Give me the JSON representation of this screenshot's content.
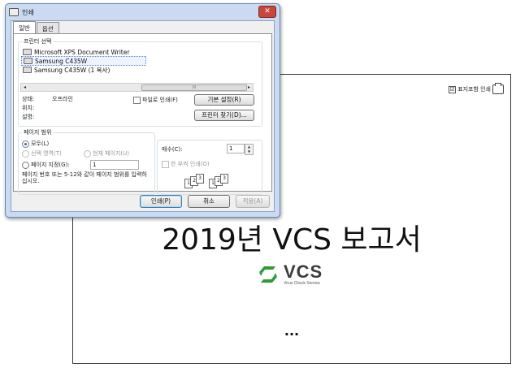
{
  "report": {
    "cover_option": "표지포함 인쇄",
    "cover_checked": "☑",
    "title": "2019년 VCS 보고서",
    "logo_text": "VCS",
    "logo_sub": "Virus Check Service",
    "ellipsis": "...",
    "colors": {
      "logo_green": "#2e9a3a"
    }
  },
  "dialog": {
    "title": "인쇄",
    "close": "✕",
    "tabs": [
      {
        "label": "일반"
      },
      {
        "label": "옵션"
      }
    ],
    "printer_section": {
      "legend": "프린터 선택",
      "printers": [
        {
          "label": "Microsoft XPS Document Writer"
        },
        {
          "label": "Samsung C435W"
        },
        {
          "label": "Samsung C435W (1 복사)"
        }
      ],
      "scroll_left": "◂",
      "scroll_right": "▸",
      "scroll_grip": "III",
      "status_label": "상태:",
      "status_value": "오프라인",
      "location_label": "위치:",
      "comment_label": "설명:",
      "print_to_file": "파일로 인쇄(F)",
      "preferences": "기본 설정(R)",
      "find_printer": "프린터 찾기(D)..."
    },
    "range_section": {
      "legend": "페이지 범위",
      "all": "모두(L)",
      "selection": "선택 영역(T)",
      "current": "현재 페이지(U)",
      "pages": "페이지 지정(G):",
      "pages_value": "1",
      "hint": "페이지 번호 또는 5-12와 같이 페이지 범위를 입력하십시오."
    },
    "copies_section": {
      "label": "매수(C):",
      "value": "1",
      "collate": "한 부씩 인쇄(O)",
      "spin_up": "▲",
      "spin_down": "▼",
      "collate_pages": [
        "1",
        "2",
        "3"
      ]
    },
    "buttons": {
      "print": "인쇄(P)",
      "cancel": "취소",
      "apply": "적용(A)"
    }
  }
}
